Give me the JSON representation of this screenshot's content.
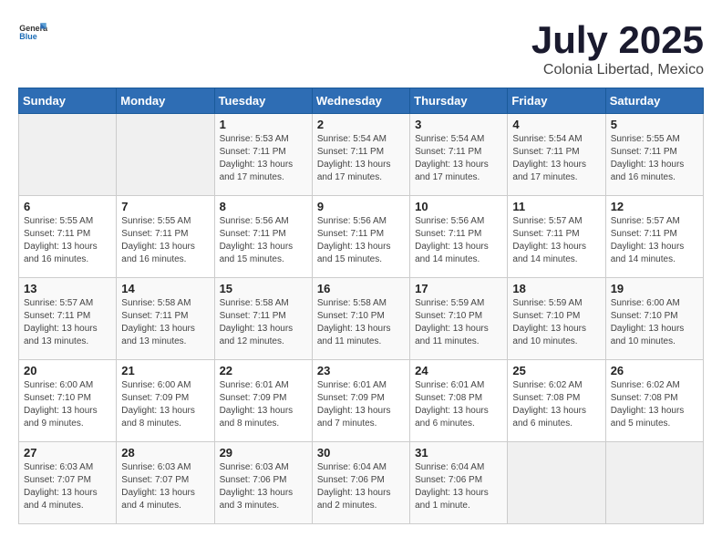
{
  "header": {
    "logo": {
      "general": "General",
      "blue": "Blue"
    },
    "month": "July 2025",
    "location": "Colonia Libertad, Mexico"
  },
  "weekdays": [
    "Sunday",
    "Monday",
    "Tuesday",
    "Wednesday",
    "Thursday",
    "Friday",
    "Saturday"
  ],
  "weeks": [
    [
      {
        "day": "",
        "info": ""
      },
      {
        "day": "",
        "info": ""
      },
      {
        "day": "1",
        "info": "Sunrise: 5:53 AM\nSunset: 7:11 PM\nDaylight: 13 hours and 17 minutes."
      },
      {
        "day": "2",
        "info": "Sunrise: 5:54 AM\nSunset: 7:11 PM\nDaylight: 13 hours and 17 minutes."
      },
      {
        "day": "3",
        "info": "Sunrise: 5:54 AM\nSunset: 7:11 PM\nDaylight: 13 hours and 17 minutes."
      },
      {
        "day": "4",
        "info": "Sunrise: 5:54 AM\nSunset: 7:11 PM\nDaylight: 13 hours and 17 minutes."
      },
      {
        "day": "5",
        "info": "Sunrise: 5:55 AM\nSunset: 7:11 PM\nDaylight: 13 hours and 16 minutes."
      }
    ],
    [
      {
        "day": "6",
        "info": "Sunrise: 5:55 AM\nSunset: 7:11 PM\nDaylight: 13 hours and 16 minutes."
      },
      {
        "day": "7",
        "info": "Sunrise: 5:55 AM\nSunset: 7:11 PM\nDaylight: 13 hours and 16 minutes."
      },
      {
        "day": "8",
        "info": "Sunrise: 5:56 AM\nSunset: 7:11 PM\nDaylight: 13 hours and 15 minutes."
      },
      {
        "day": "9",
        "info": "Sunrise: 5:56 AM\nSunset: 7:11 PM\nDaylight: 13 hours and 15 minutes."
      },
      {
        "day": "10",
        "info": "Sunrise: 5:56 AM\nSunset: 7:11 PM\nDaylight: 13 hours and 14 minutes."
      },
      {
        "day": "11",
        "info": "Sunrise: 5:57 AM\nSunset: 7:11 PM\nDaylight: 13 hours and 14 minutes."
      },
      {
        "day": "12",
        "info": "Sunrise: 5:57 AM\nSunset: 7:11 PM\nDaylight: 13 hours and 14 minutes."
      }
    ],
    [
      {
        "day": "13",
        "info": "Sunrise: 5:57 AM\nSunset: 7:11 PM\nDaylight: 13 hours and 13 minutes."
      },
      {
        "day": "14",
        "info": "Sunrise: 5:58 AM\nSunset: 7:11 PM\nDaylight: 13 hours and 13 minutes."
      },
      {
        "day": "15",
        "info": "Sunrise: 5:58 AM\nSunset: 7:11 PM\nDaylight: 13 hours and 12 minutes."
      },
      {
        "day": "16",
        "info": "Sunrise: 5:58 AM\nSunset: 7:10 PM\nDaylight: 13 hours and 11 minutes."
      },
      {
        "day": "17",
        "info": "Sunrise: 5:59 AM\nSunset: 7:10 PM\nDaylight: 13 hours and 11 minutes."
      },
      {
        "day": "18",
        "info": "Sunrise: 5:59 AM\nSunset: 7:10 PM\nDaylight: 13 hours and 10 minutes."
      },
      {
        "day": "19",
        "info": "Sunrise: 6:00 AM\nSunset: 7:10 PM\nDaylight: 13 hours and 10 minutes."
      }
    ],
    [
      {
        "day": "20",
        "info": "Sunrise: 6:00 AM\nSunset: 7:10 PM\nDaylight: 13 hours and 9 minutes."
      },
      {
        "day": "21",
        "info": "Sunrise: 6:00 AM\nSunset: 7:09 PM\nDaylight: 13 hours and 8 minutes."
      },
      {
        "day": "22",
        "info": "Sunrise: 6:01 AM\nSunset: 7:09 PM\nDaylight: 13 hours and 8 minutes."
      },
      {
        "day": "23",
        "info": "Sunrise: 6:01 AM\nSunset: 7:09 PM\nDaylight: 13 hours and 7 minutes."
      },
      {
        "day": "24",
        "info": "Sunrise: 6:01 AM\nSunset: 7:08 PM\nDaylight: 13 hours and 6 minutes."
      },
      {
        "day": "25",
        "info": "Sunrise: 6:02 AM\nSunset: 7:08 PM\nDaylight: 13 hours and 6 minutes."
      },
      {
        "day": "26",
        "info": "Sunrise: 6:02 AM\nSunset: 7:08 PM\nDaylight: 13 hours and 5 minutes."
      }
    ],
    [
      {
        "day": "27",
        "info": "Sunrise: 6:03 AM\nSunset: 7:07 PM\nDaylight: 13 hours and 4 minutes."
      },
      {
        "day": "28",
        "info": "Sunrise: 6:03 AM\nSunset: 7:07 PM\nDaylight: 13 hours and 4 minutes."
      },
      {
        "day": "29",
        "info": "Sunrise: 6:03 AM\nSunset: 7:06 PM\nDaylight: 13 hours and 3 minutes."
      },
      {
        "day": "30",
        "info": "Sunrise: 6:04 AM\nSunset: 7:06 PM\nDaylight: 13 hours and 2 minutes."
      },
      {
        "day": "31",
        "info": "Sunrise: 6:04 AM\nSunset: 7:06 PM\nDaylight: 13 hours and 1 minute."
      },
      {
        "day": "",
        "info": ""
      },
      {
        "day": "",
        "info": ""
      }
    ]
  ]
}
